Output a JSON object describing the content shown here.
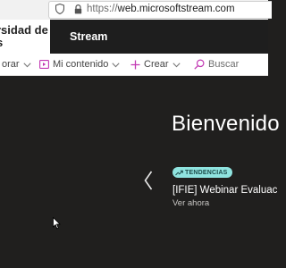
{
  "browser": {
    "url_scheme": "https://",
    "url_domain": "web.microsoftstream.com"
  },
  "header": {
    "org_name_line1": "rsidad de",
    "org_name_line2": "s",
    "app_name": "Stream"
  },
  "toolbar": {
    "explore_label": "orar",
    "content_label": "Mi contenido",
    "create_label": "Crear",
    "search_label": "Buscar"
  },
  "hero": {
    "title": "Bienvenido",
    "badge_label": "TENDENCIAS",
    "item_title": "[IFIE] Webinar Evaluac",
    "item_link": "Ver ahora"
  },
  "colors": {
    "hero_bg": "#201f1e",
    "header_bg": "#1e1e1e",
    "accent_pink": "#c239b3",
    "badge_bg": "#8fe3df"
  },
  "icons": {
    "shield": "shield-icon",
    "lock": "lock-icon",
    "content": "video-icon",
    "create": "plus-icon",
    "search": "search-icon",
    "prev": "chevron-left-icon",
    "trending": "trending-icon"
  }
}
